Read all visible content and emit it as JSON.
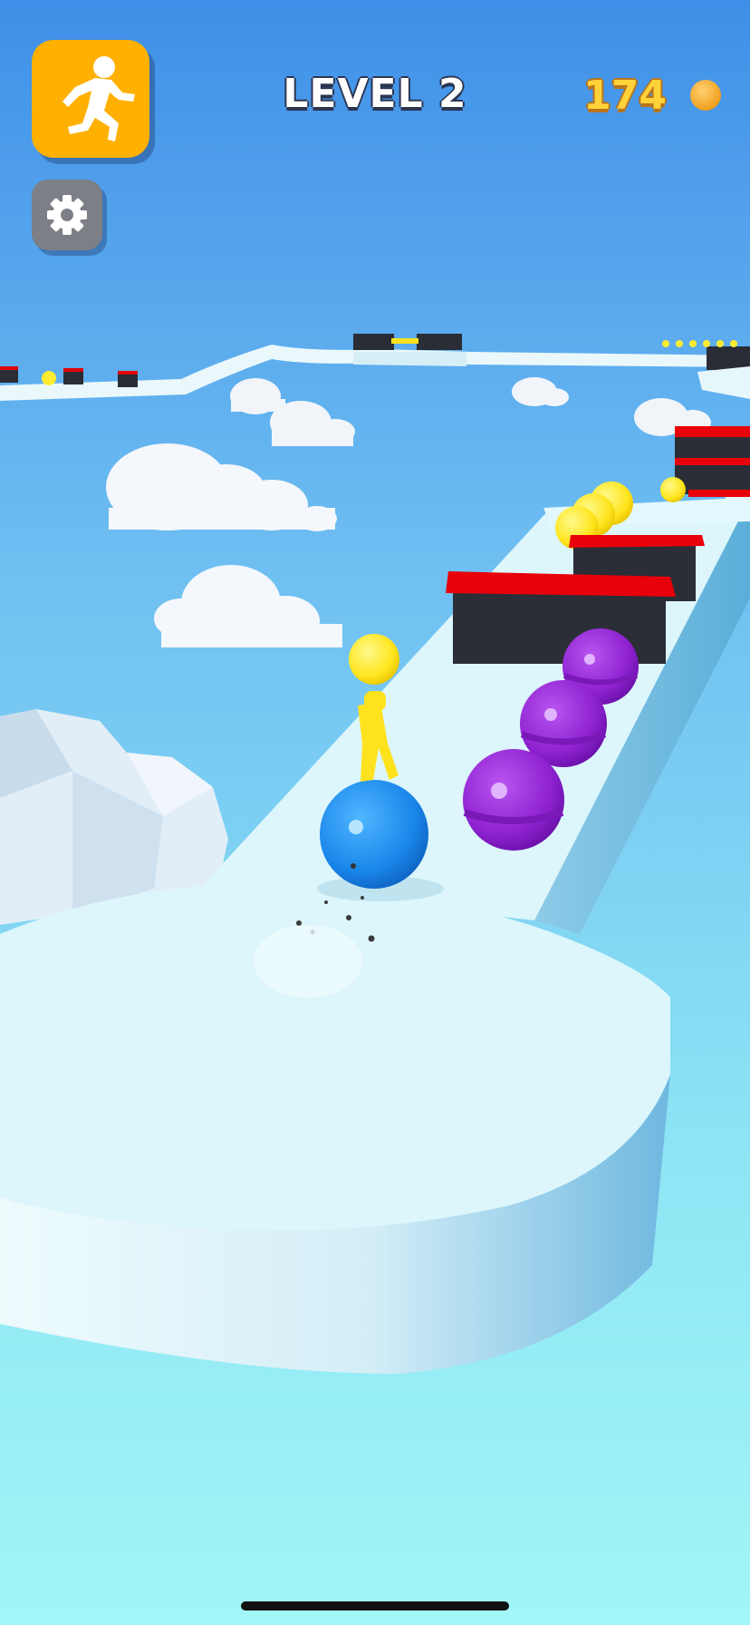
{
  "hud": {
    "level_label": "LEVEL 2",
    "coins": "174",
    "skin_button_icon": "running-man-icon",
    "settings_icon": "gear-icon",
    "coin_icon": "coin-icon"
  },
  "colors": {
    "sky_top": "#3f8fe8",
    "sky_bottom": "#9ff5f7",
    "ice": "#dff7fb",
    "player_body": "#ffee2e",
    "player_ball": "#1e8ef5",
    "obstacle_ball": "#9a2fd8",
    "wall_top": "#e8000b",
    "wall_body": "#2b2e36",
    "skin_button": "#ffb000",
    "settings_button": "#7d7f86",
    "coin": "#f0a020"
  }
}
